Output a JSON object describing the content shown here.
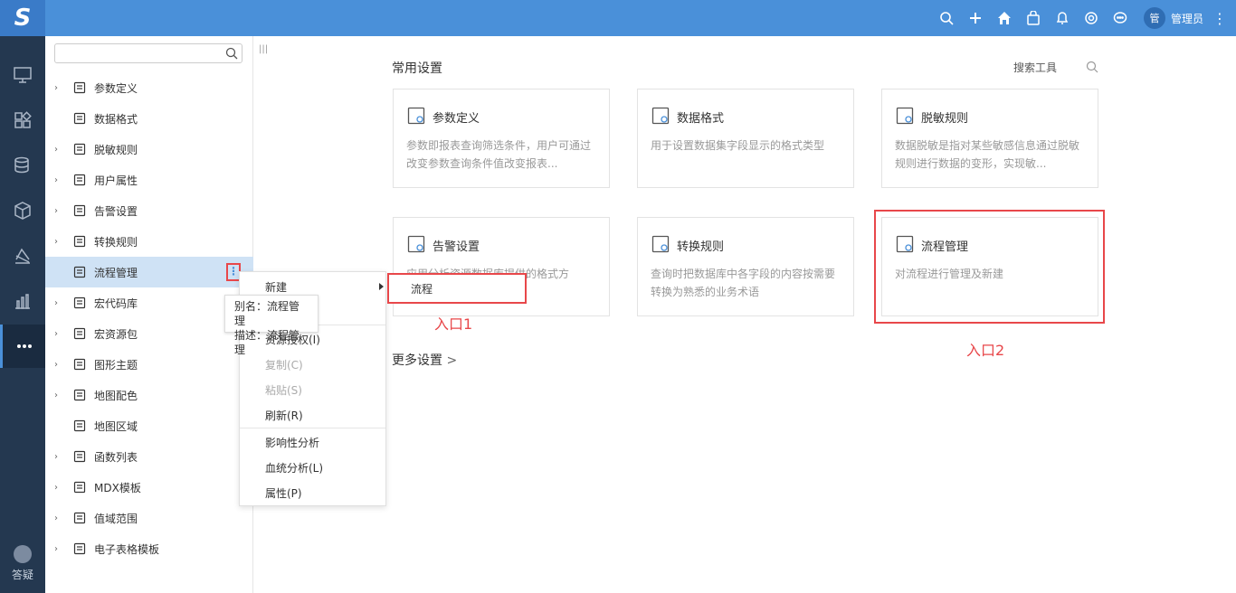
{
  "app": {
    "logo_text": "S"
  },
  "topbar": {
    "icons": [
      "search-icon",
      "plus-icon",
      "home-icon",
      "bag-icon",
      "bell-icon",
      "gear-icon",
      "chat-icon"
    ],
    "avatar_text": "管",
    "username": "管理员",
    "more": "⋮"
  },
  "rail": {
    "items": [
      "monitor-icon",
      "apps-icon",
      "database-icon",
      "cube-icon",
      "chart-stack-icon",
      "bar-chart-icon",
      "more-dots-icon"
    ],
    "help_label": "答疑"
  },
  "tree": {
    "search_placeholder": "",
    "items": [
      {
        "label": "参数定义",
        "icon": "param-icon",
        "expandable": true
      },
      {
        "label": "数据格式",
        "icon": "format-icon",
        "expandable": false
      },
      {
        "label": "脱敏规则",
        "icon": "mask-icon",
        "expandable": true
      },
      {
        "label": "用户属性",
        "icon": "user-attr-icon",
        "expandable": true
      },
      {
        "label": "告警设置",
        "icon": "flag-icon",
        "expandable": true
      },
      {
        "label": "转换规则",
        "icon": "convert-icon",
        "expandable": true
      },
      {
        "label": "流程管理",
        "icon": "flow-icon",
        "expandable": false
      },
      {
        "label": "宏代码库",
        "icon": "macro-icon",
        "expandable": true
      },
      {
        "label": "宏资源包",
        "icon": "package-icon",
        "expandable": true
      },
      {
        "label": "图形主题",
        "icon": "theme-icon",
        "expandable": true
      },
      {
        "label": "地图配色",
        "icon": "palette-icon",
        "expandable": true
      },
      {
        "label": "地图区域",
        "icon": "pin-icon",
        "expandable": false
      },
      {
        "label": "函数列表",
        "icon": "function-icon",
        "expandable": true
      },
      {
        "label": "MDX模板",
        "icon": "mdx-icon",
        "expandable": true
      },
      {
        "label": "值域范围",
        "icon": "range-icon",
        "expandable": true
      },
      {
        "label": "电子表格模板",
        "icon": "sheet-icon",
        "expandable": true
      }
    ],
    "more_button": "⋮"
  },
  "tooltip": {
    "alias": "别名：流程管理",
    "desc": "描述：流程管理"
  },
  "context_menu": {
    "new_label": "新建",
    "items": [
      {
        "label": "资源授权(I)",
        "disabled": false
      },
      {
        "label": "复制(C)",
        "disabled": true
      },
      {
        "label": "粘贴(S)",
        "disabled": true
      },
      {
        "label": "刷新(R)",
        "disabled": false
      },
      {
        "label": "影响性分析",
        "disabled": false
      },
      {
        "label": "血统分析(L)",
        "disabled": false
      },
      {
        "label": "属性(P)",
        "disabled": false
      }
    ],
    "submenu_item": "流程"
  },
  "annotations": {
    "entry1": "入口1",
    "entry2": "入口2"
  },
  "main": {
    "section_title": "常用设置",
    "search_tool": "搜索工具",
    "cards": [
      {
        "title": "参数定义",
        "icon": "param-icon",
        "desc": "参数即报表查询筛选条件，用户可通过改变参数查询条件值改变报表..."
      },
      {
        "title": "数据格式",
        "icon": "percent-format-icon",
        "desc": "用于设置数据集字段显示的格式类型"
      },
      {
        "title": "脱敏规则",
        "icon": "mask-icon",
        "desc": "数据脱敏是指对某些敏感信息通过脱敏规则进行数据的变形，实现敏..."
      },
      {
        "title": "告警设置",
        "icon": "flag-icon",
        "desc": "应用分析资源数据库提供的格式方"
      },
      {
        "title": "转换规则",
        "icon": "convert-icon",
        "desc": "查询时把数据库中各字段的内容按需要转换为熟悉的业务术语"
      },
      {
        "title": "流程管理",
        "icon": "flow-icon",
        "desc": "对流程进行管理及新建"
      }
    ],
    "more_settings": "更多设置"
  },
  "colors": {
    "topbar": "#4a90d9",
    "rail": "#243850",
    "selected": "#cfe2f5",
    "annotation_red": "#e8474a"
  }
}
